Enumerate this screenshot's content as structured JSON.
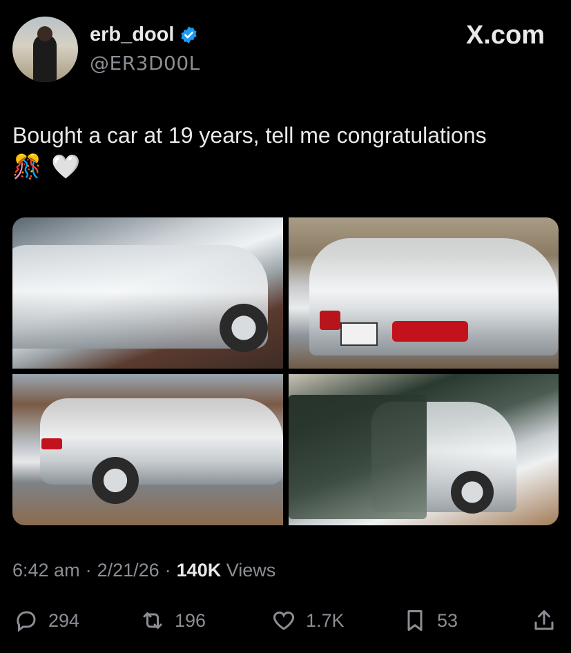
{
  "author": {
    "display_name": "erb_dool",
    "handle": "@ER3D00L",
    "verified": true
  },
  "brand": {
    "site_label": "X.com"
  },
  "post": {
    "text": "Bought a car at 19 years, tell me congratulations",
    "emojis": [
      "🎊",
      "🤍"
    ]
  },
  "media": {
    "photos": [
      "car-photo-1",
      "car-photo-2",
      "car-photo-3",
      "car-photo-4"
    ]
  },
  "meta": {
    "time": "6:42 am",
    "separator": "·",
    "date": "2/21/26",
    "views_count": "140K",
    "views_label": "Views"
  },
  "actions": {
    "replies": "294",
    "reposts": "196",
    "likes": "1.7K",
    "bookmarks": "53"
  },
  "colors": {
    "background": "#000000",
    "text_primary": "#e7e9ea",
    "text_secondary": "#8b8f94",
    "verified_blue": "#1d9bf0"
  },
  "icons": [
    "verified-badge-icon",
    "reply-icon",
    "repost-icon",
    "like-icon",
    "bookmark-icon",
    "share-icon"
  ]
}
